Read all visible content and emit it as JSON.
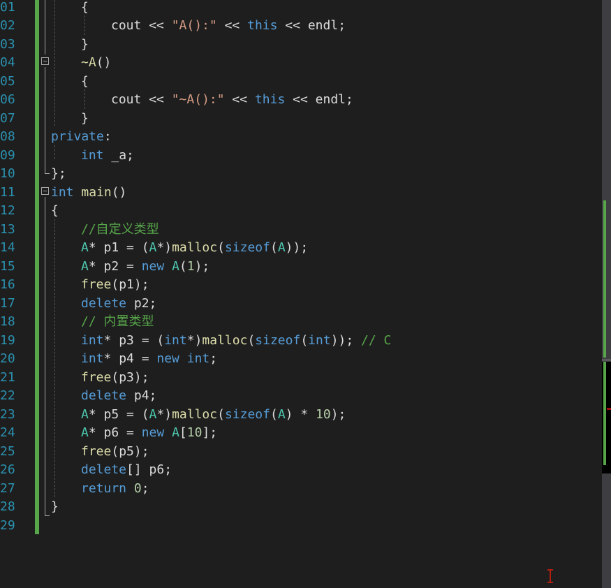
{
  "editor": {
    "line_numbers": [
      "01",
      "02",
      "03",
      "04",
      "05",
      "06",
      "07",
      "08",
      "09",
      "10",
      "11",
      "12",
      "13",
      "14",
      "15",
      "16",
      "17",
      "18",
      "19",
      "20",
      "21",
      "22",
      "23",
      "24",
      "25",
      "26",
      "27",
      "28",
      "29"
    ],
    "lines": [
      [
        {
          "t": "{",
          "c": "pl"
        }
      ],
      [
        {
          "t": "cout",
          "c": "pl"
        },
        {
          "t": " << ",
          "c": "pl"
        },
        {
          "t": "\"A():\"",
          "c": "st"
        },
        {
          "t": " << ",
          "c": "pl"
        },
        {
          "t": "this",
          "c": "kw"
        },
        {
          "t": " << ",
          "c": "pl"
        },
        {
          "t": "endl",
          "c": "pl"
        },
        {
          "t": ";",
          "c": "pl"
        }
      ],
      [
        {
          "t": "}",
          "c": "pl"
        }
      ],
      [
        {
          "t": "~A",
          "c": "fn"
        },
        {
          "t": "()",
          "c": "pl"
        }
      ],
      [
        {
          "t": "{",
          "c": "pl"
        }
      ],
      [
        {
          "t": "cout",
          "c": "pl"
        },
        {
          "t": " << ",
          "c": "pl"
        },
        {
          "t": "\"~A():\"",
          "c": "st"
        },
        {
          "t": " << ",
          "c": "pl"
        },
        {
          "t": "this",
          "c": "kw"
        },
        {
          "t": " << ",
          "c": "pl"
        },
        {
          "t": "endl",
          "c": "pl"
        },
        {
          "t": ";",
          "c": "pl"
        }
      ],
      [
        {
          "t": "}",
          "c": "pl"
        }
      ],
      [
        {
          "t": "private",
          "c": "kw"
        },
        {
          "t": ":",
          "c": "pl"
        }
      ],
      [
        {
          "t": "int",
          "c": "kw"
        },
        {
          "t": " _a;",
          "c": "pl"
        }
      ],
      [
        {
          "t": "};",
          "c": "pl"
        }
      ],
      [
        {
          "t": "int",
          "c": "kw"
        },
        {
          "t": " ",
          "c": "pl"
        },
        {
          "t": "main",
          "c": "fn"
        },
        {
          "t": "()",
          "c": "pl"
        }
      ],
      [
        {
          "t": "{",
          "c": "pl"
        }
      ],
      [
        {
          "t": "//自定义类型",
          "c": "cm"
        }
      ],
      [
        {
          "t": "A",
          "c": "ty"
        },
        {
          "t": "* p1 = (",
          "c": "pl"
        },
        {
          "t": "A",
          "c": "ty"
        },
        {
          "t": "*)",
          "c": "pl"
        },
        {
          "t": "malloc",
          "c": "fn"
        },
        {
          "t": "(",
          "c": "pl"
        },
        {
          "t": "sizeof",
          "c": "kw"
        },
        {
          "t": "(",
          "c": "pl"
        },
        {
          "t": "A",
          "c": "ty"
        },
        {
          "t": "));",
          "c": "pl"
        }
      ],
      [
        {
          "t": "A",
          "c": "ty"
        },
        {
          "t": "* p2 = ",
          "c": "pl"
        },
        {
          "t": "new",
          "c": "kw"
        },
        {
          "t": " ",
          "c": "pl"
        },
        {
          "t": "A",
          "c": "ty"
        },
        {
          "t": "(",
          "c": "pl"
        },
        {
          "t": "1",
          "c": "nu"
        },
        {
          "t": ");",
          "c": "pl"
        }
      ],
      [
        {
          "t": "free",
          "c": "fn"
        },
        {
          "t": "(p1);",
          "c": "pl"
        }
      ],
      [
        {
          "t": "delete",
          "c": "kw"
        },
        {
          "t": " p2;",
          "c": "pl"
        }
      ],
      [
        {
          "t": "// 内置类型",
          "c": "cm"
        }
      ],
      [
        {
          "t": "int",
          "c": "kw"
        },
        {
          "t": "* p3 = (",
          "c": "pl"
        },
        {
          "t": "int",
          "c": "kw"
        },
        {
          "t": "*)",
          "c": "pl"
        },
        {
          "t": "malloc",
          "c": "fn"
        },
        {
          "t": "(",
          "c": "pl"
        },
        {
          "t": "sizeof",
          "c": "kw"
        },
        {
          "t": "(",
          "c": "pl"
        },
        {
          "t": "int",
          "c": "kw"
        },
        {
          "t": ")); ",
          "c": "pl"
        },
        {
          "t": "// C",
          "c": "cm"
        }
      ],
      [
        {
          "t": "int",
          "c": "kw"
        },
        {
          "t": "* p4 = ",
          "c": "pl"
        },
        {
          "t": "new",
          "c": "kw"
        },
        {
          "t": " ",
          "c": "pl"
        },
        {
          "t": "int",
          "c": "kw"
        },
        {
          "t": ";",
          "c": "pl"
        }
      ],
      [
        {
          "t": "free",
          "c": "fn"
        },
        {
          "t": "(p3);",
          "c": "pl"
        }
      ],
      [
        {
          "t": "delete",
          "c": "kw"
        },
        {
          "t": " p4;",
          "c": "pl"
        }
      ],
      [
        {
          "t": "A",
          "c": "ty"
        },
        {
          "t": "* p5 = (",
          "c": "pl"
        },
        {
          "t": "A",
          "c": "ty"
        },
        {
          "t": "*)",
          "c": "pl"
        },
        {
          "t": "malloc",
          "c": "fn"
        },
        {
          "t": "(",
          "c": "pl"
        },
        {
          "t": "sizeof",
          "c": "kw"
        },
        {
          "t": "(",
          "c": "pl"
        },
        {
          "t": "A",
          "c": "ty"
        },
        {
          "t": ") * ",
          "c": "pl"
        },
        {
          "t": "10",
          "c": "nu"
        },
        {
          "t": ");",
          "c": "pl"
        }
      ],
      [
        {
          "t": "A",
          "c": "ty"
        },
        {
          "t": "* p6 = ",
          "c": "pl"
        },
        {
          "t": "new",
          "c": "kw"
        },
        {
          "t": " ",
          "c": "pl"
        },
        {
          "t": "A",
          "c": "ty"
        },
        {
          "t": "[",
          "c": "pl"
        },
        {
          "t": "10",
          "c": "nu"
        },
        {
          "t": "];",
          "c": "pl"
        }
      ],
      [
        {
          "t": "free",
          "c": "fn"
        },
        {
          "t": "(p5);",
          "c": "pl"
        }
      ],
      [
        {
          "t": "delete",
          "c": "kw"
        },
        {
          "t": "[] p6;",
          "c": "pl"
        }
      ],
      [
        {
          "t": "return",
          "c": "kw"
        },
        {
          "t": " ",
          "c": "pl"
        },
        {
          "t": "0",
          "c": "nu"
        },
        {
          "t": ";",
          "c": "pl"
        }
      ],
      [
        {
          "t": "}",
          "c": "pl"
        }
      ],
      []
    ]
  },
  "colors": {
    "background": "#1e1e1e",
    "line_number": "#2b91af",
    "keyword": "#569cd6",
    "type": "#4ec9b0",
    "function": "#dcdcaa",
    "string": "#d69d85",
    "comment": "#57a64a",
    "number": "#b5cea8",
    "change_bar": "#57a64a"
  }
}
